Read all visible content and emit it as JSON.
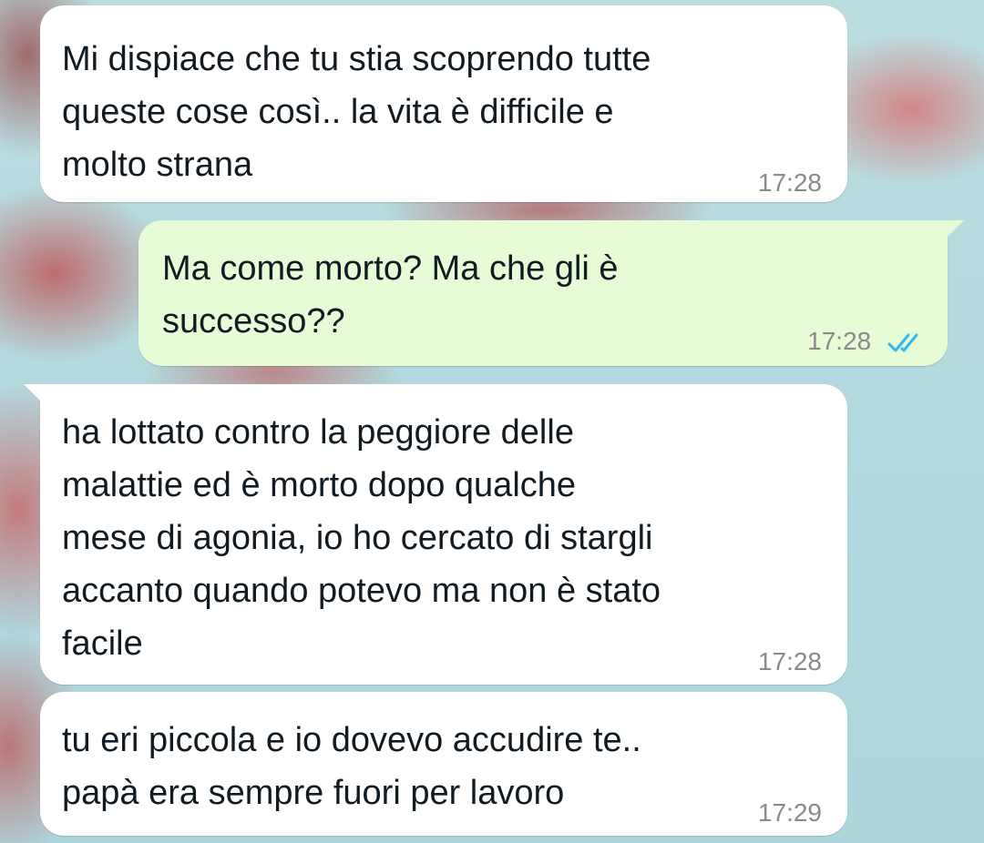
{
  "messages": [
    {
      "direction": "incoming",
      "text": "Mi dispiace che tu stia scoprendo tutte\nqueste cose così.. la vita è difficile e\nmolto strana",
      "time": "17:28"
    },
    {
      "direction": "outgoing",
      "text": "Ma come morto? Ma che gli è\nsuccesso??",
      "time": "17:28",
      "status": "read",
      "status_icon": "double-check-icon"
    },
    {
      "direction": "incoming",
      "text": "ha lottato contro la peggiore delle\nmalattie ed è morto dopo qualche\nmese di agonia, io ho cercato di stargli\naccanto quando potevo ma non è stato\nfacile",
      "time": "17:28"
    },
    {
      "direction": "incoming",
      "text": "tu eri piccola e io dovevo accudire te..\npapà era sempre fuori per lavoro",
      "time": "17:29"
    }
  ],
  "colors": {
    "incoming_bubble": "#ffffff",
    "outgoing_bubble": "#e6fbd6",
    "read_ticks": "#34b7f1",
    "timestamp": "#8a8a8a"
  }
}
